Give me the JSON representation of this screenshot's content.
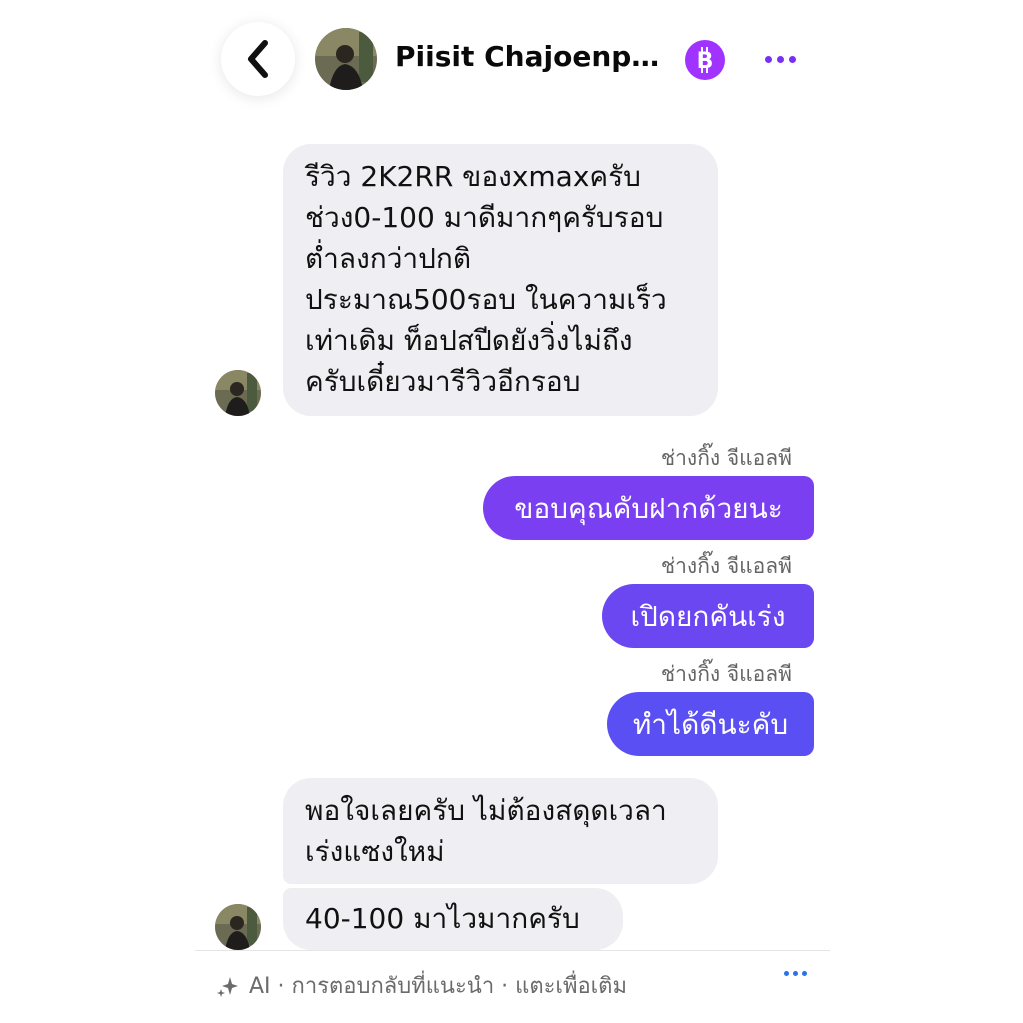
{
  "header": {
    "contact_name": "Piisit Chajoenph...",
    "back_icon": "chevron-left-icon",
    "coin_icon": "bitcoin-icon",
    "coin_color": "#a033ff",
    "more_icon": "more-horizontal-icon"
  },
  "messages": [
    {
      "direction": "incoming",
      "text": "รีวิว 2K2RR ของxmaxครับ\nช่วง0-100 มาดีมากๆครับรอบ\nต่ำลงกว่าปกติ\nประมาณ500รอบ ในความเร็ว\nเท่าเดิม ท็อปสปีดยังวิ่งไม่ถึง\nครับเดี๋ยวมารีวิวอีกรอบ"
    },
    {
      "direction": "outgoing",
      "sender": "ช่างกิ๊ง จีแอลพี",
      "text": "ขอบคุณคับฝากด้วยนะ",
      "color": "#7a3ff0"
    },
    {
      "direction": "outgoing",
      "sender": "ช่างกิ๊ง จีแอลพี",
      "text": "เปิดยกคันเร่ง",
      "color": "#6a47f1"
    },
    {
      "direction": "outgoing",
      "sender": "ช่างกิ๊ง จีแอลพี",
      "text": "ทำได้ดีนะคับ",
      "color": "#5a4ff2"
    },
    {
      "direction": "incoming",
      "text": "พอใจเลยครับ ไม่ต้องสดุดเวลา\nเร่งแซงใหม่"
    },
    {
      "direction": "incoming",
      "text": "40-100 มาไวมากครับ"
    }
  ],
  "ai_suggestions": {
    "icon": "sparkle-icon",
    "text": "AI · การตอบกลับที่แนะนำ · แตะเพื่อเติม",
    "more_icon": "more-horizontal-icon"
  },
  "colors": {
    "incoming_bubble": "#efeff3",
    "accent": "#7a2ff6",
    "link_dots": "#2a72e5"
  }
}
